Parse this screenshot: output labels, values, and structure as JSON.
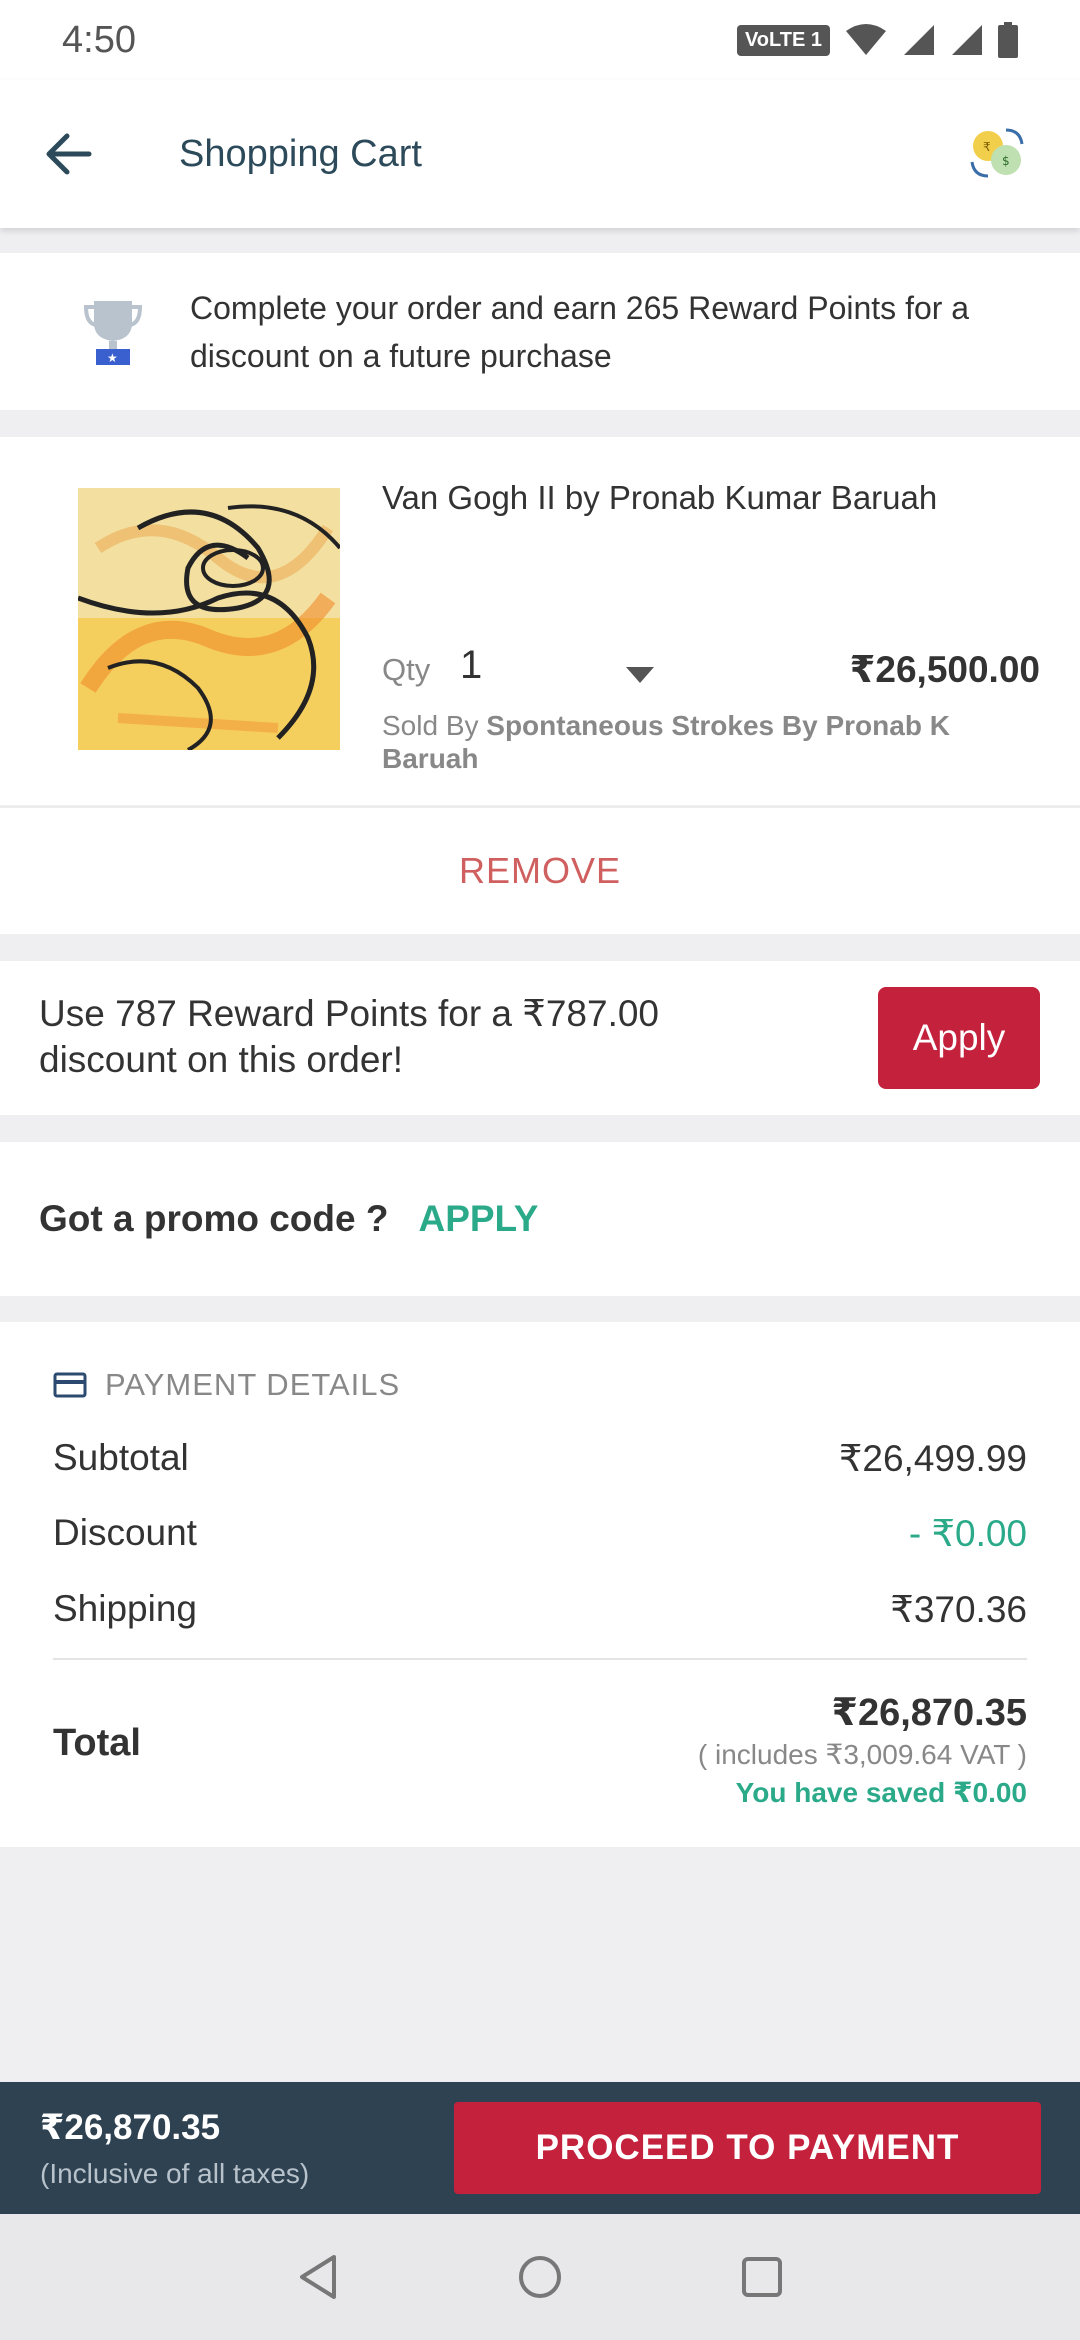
{
  "status_bar": {
    "time": "4:50",
    "network_badge": "VoLTE 1"
  },
  "app_bar": {
    "title": "Shopping Cart"
  },
  "reward_banner": {
    "message": "Complete your order and earn 265 Reward Points for a discount on a future purchase"
  },
  "cart_item": {
    "name": "Van Gogh II by Pronab Kumar Baruah",
    "qty_label": "Qty",
    "qty_value": "1",
    "price": "₹26,500.00",
    "sold_by_prefix": "Sold By",
    "seller": "Spontaneous Strokes By Pronab K Baruah"
  },
  "remove": {
    "label": "REMOVE"
  },
  "redeem": {
    "message": "Use 787 Reward Points for a ₹787.00 discount on this order!",
    "apply_label": "Apply"
  },
  "promo": {
    "question": "Got a promo code ?",
    "apply_label": "APPLY"
  },
  "payment": {
    "header": "PAYMENT DETAILS",
    "subtotal_label": "Subtotal",
    "subtotal_value": "₹26,499.99",
    "discount_label": "Discount",
    "discount_value": "- ₹0.00",
    "shipping_label": "Shipping",
    "shipping_value": "₹370.36",
    "total_label": "Total",
    "total_value": "₹26,870.35",
    "vat_note": "( includes  ₹3,009.64  VAT )",
    "saved_note": "You have saved ₹0.00"
  },
  "bottom_bar": {
    "amount": "₹26,870.35",
    "note": "(Inclusive of all taxes)",
    "proceed_label": "PROCEED TO PAYMENT"
  },
  "colors": {
    "accent": "#c4213d",
    "success": "#2baa8a",
    "bottom_bar": "#2f4252",
    "remove": "#d06060"
  },
  "icons": [
    "back-arrow-icon",
    "currency-switch-icon",
    "trophy-icon",
    "dropdown-caret-icon",
    "card-icon",
    "nav-back-icon",
    "nav-home-icon",
    "nav-recents-icon"
  ]
}
